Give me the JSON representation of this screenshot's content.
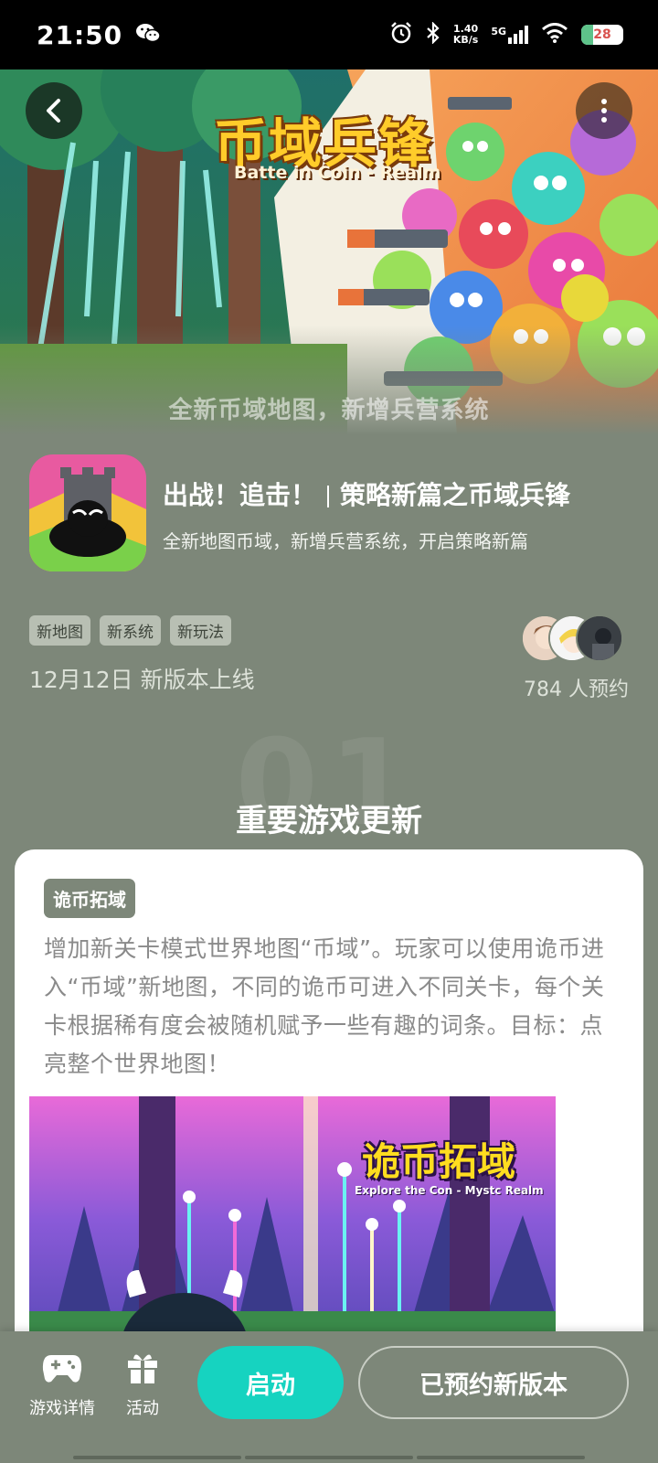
{
  "status_bar": {
    "time": "21:50",
    "net_speed_value": "1.40",
    "net_speed_unit": "KB/s",
    "network": "5G",
    "battery": "28",
    "icons": [
      "wechat-icon",
      "alarm-icon",
      "bluetooth-icon",
      "signal-icon",
      "wifi-icon",
      "battery-icon"
    ]
  },
  "hero": {
    "title": "币域兵锋",
    "subtitle": "Batte in Coin - Realm",
    "caption": "全新币域地图，新增兵营系统"
  },
  "game": {
    "headline_part1": "出战！追击！",
    "headline_part2": "策略新篇之币域兵锋",
    "sub_headline": "全新地图币域，新增兵营系统，开启策略新篇",
    "tags": [
      "新地图",
      "新系统",
      "新玩法"
    ],
    "release": "12月12日 新版本上线",
    "reservation_count": "784 人预约"
  },
  "section": {
    "number": "01",
    "title": "重要游戏更新"
  },
  "card": {
    "tag": "诡币拓域",
    "body": "增加新关卡模式世界地图“币域”。玩家可以使用诡币进入“币域”新地图，不同的诡币可进入不同关卡，每个关卡根据稀有度会被随机赋予一些有趣的词条。目标：点亮整个世界地图！",
    "image_title": "诡币拓域",
    "image_subtitle": "Explore the Con - Mystc Realm"
  },
  "bottom_bar": {
    "game_details_label": "游戏详情",
    "events_label": "活动",
    "launch_label": "启动",
    "reserved_label": "已预约新版本"
  },
  "colors": {
    "background": "#7d8779",
    "launch_button": "#16d3c0",
    "card": "#ffffff",
    "hero_title": "#ffcc2a"
  }
}
